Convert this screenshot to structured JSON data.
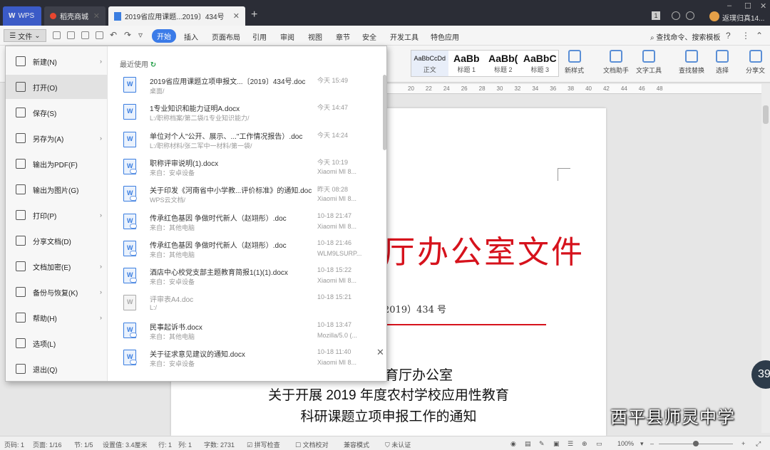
{
  "titlebar": {
    "tabs": [
      {
        "label": "WPS",
        "logo": "W"
      },
      {
        "label": "稻壳商城"
      },
      {
        "label": "2019省应用课题...2019〕434号"
      }
    ],
    "notif_count": "1",
    "user": "返璞归真14..."
  },
  "menubar": {
    "file_label": "文件",
    "tabs": [
      "开始",
      "插入",
      "页面布局",
      "引用",
      "审阅",
      "视图",
      "章节",
      "安全",
      "开发工具",
      "特色应用"
    ],
    "search": "查找命令、搜索模板"
  },
  "ribbon": {
    "styles": [
      {
        "sample": "AaBbCcDd",
        "name": "正文"
      },
      {
        "sample": "AaBb",
        "name": "标题 1"
      },
      {
        "sample": "AaBb(",
        "name": "标题 2"
      },
      {
        "sample": "AaBbC",
        "name": "标题 3"
      }
    ],
    "new_style": "新样式",
    "doc_helper": "文档助手",
    "text_tools": "文字工具",
    "find_replace": "查找替换",
    "select": "选择",
    "share": "分享文"
  },
  "ruler_ticks": [
    "20",
    "22",
    "24",
    "26",
    "28",
    "30",
    "32",
    "34",
    "36",
    "38",
    "40",
    "42",
    "44",
    "46",
    "48"
  ],
  "file_menu": {
    "items": [
      {
        "label": "新建(N)",
        "arrow": true
      },
      {
        "label": "打开(O)",
        "arrow": false
      },
      {
        "label": "保存(S)",
        "arrow": false
      },
      {
        "label": "另存为(A)",
        "arrow": true
      },
      {
        "label": "输出为PDF(F)",
        "arrow": false
      },
      {
        "label": "输出为图片(G)",
        "arrow": false
      },
      {
        "label": "打印(P)",
        "arrow": true
      },
      {
        "label": "分享文档(D)",
        "arrow": false
      },
      {
        "label": "文档加密(E)",
        "arrow": true
      },
      {
        "label": "备份与恢复(K)",
        "arrow": true
      },
      {
        "label": "帮助(H)",
        "arrow": true
      },
      {
        "label": "选项(L)",
        "arrow": false
      },
      {
        "label": "退出(Q)",
        "arrow": false
      }
    ],
    "recent_title": "最近使用",
    "recent_files": [
      {
        "name": "2019省应用课题立项申报文...〔2019〕434号.doc",
        "path": "桌面/",
        "time": "今天 15:49",
        "device": ""
      },
      {
        "name": "1专业知识和能力证明A.docx",
        "path": "L:/职称档案/第二袋/1专业知识能力/",
        "time": "今天 14:47",
        "device": ""
      },
      {
        "name": "单位对个人\"公开、展示、...\"工作情况报告）.doc",
        "path": "L:/职称材料/张二军中一材料/第一袋/",
        "time": "今天 14:24",
        "device": ""
      },
      {
        "name": "职称评审说明(1).docx",
        "path": "来自：安卓设备",
        "time": "今天 10:19",
        "device": "Xiaomi MI 8..."
      },
      {
        "name": "关于印发《河南省中小学教...评价标准》的通知.doc",
        "path": "WPS云文档/",
        "time": "昨天 08:28",
        "device": "Xiaomi MI 8..."
      },
      {
        "name": "传承红色基因 争做时代新人（赵翊彤）.doc",
        "path": "来自：其他电脑",
        "time": "10-18 21:47",
        "device": "Xiaomi MI 8..."
      },
      {
        "name": "传承红色基因 争做时代新人（赵翊彤）.doc",
        "path": "来自：其他电脑",
        "time": "10-18 21:46",
        "device": "WLM9LSURP..."
      },
      {
        "name": "酒店中心校党支部主题教育简报1(1)(1).docx",
        "path": "来自：安卓设备",
        "time": "10-18 15:22",
        "device": "Xiaomi MI 8..."
      },
      {
        "name": "评审表A4.doc",
        "path": "L:/",
        "time": "10-18 15:21",
        "device": ""
      },
      {
        "name": "民事起诉书.docx",
        "path": "来自：其他电脑",
        "time": "10-18 13:47",
        "device": "Mozilla/5.0 (..."
      },
      {
        "name": "关于征求意见建议的通知.docx",
        "path": "来自：安卓设备",
        "time": "10-18 11:40",
        "device": "Xiaomi MI 8..."
      }
    ]
  },
  "document": {
    "red_title": "厅办公室文件",
    "doc_number": "2019）434 号",
    "office": "育厅办公室",
    "notice_line1": "关于开展 2019 年度农村学校应用性教育",
    "notice_line2": "科研课题立项申报工作的通知"
  },
  "overlay": {
    "badge": "39",
    "watermark": "西平县师灵中学"
  },
  "status": {
    "page_code": "页码: 1",
    "page": "页面: 1/16",
    "section": "节: 1/5",
    "setting": "设置值: 3.4厘米",
    "row": "行: 1",
    "col": "列: 1",
    "chars": "字数: 2731",
    "spell": "拼写检查",
    "proof": "文档校对",
    "compat": "兼容模式",
    "cert": "未认证",
    "zoom": "100%"
  }
}
